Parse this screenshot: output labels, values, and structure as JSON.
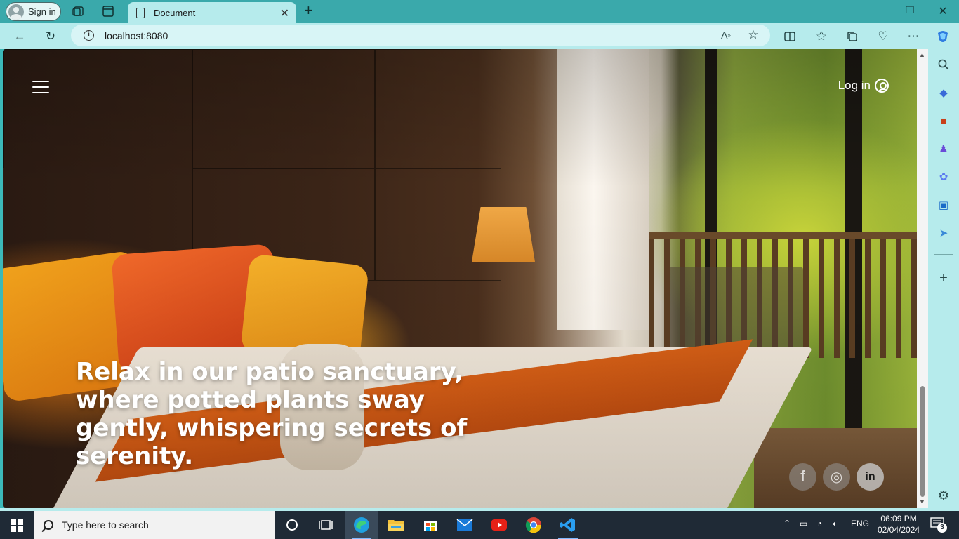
{
  "browser": {
    "profile_label": "Sign in",
    "tab_title": "Document",
    "url": "localhost:8080"
  },
  "page": {
    "login_label": "Log in",
    "hero_text": "Relax in our patio sanctuary, where potted plants sway gently, whispering secrets of serenity.",
    "socials": [
      {
        "name": "facebook",
        "glyph": "f"
      },
      {
        "name": "instagram",
        "glyph": "◎"
      },
      {
        "name": "linkedin",
        "glyph": "in"
      }
    ]
  },
  "taskbar": {
    "search_placeholder": "Type here to search",
    "language": "ENG",
    "time": "06:09 PM",
    "date": "02/04/2024",
    "notification_count": "3"
  },
  "colors": {
    "browser_frame": "#3aa9ab",
    "toolbar": "#b6ebec",
    "taskbar": "#1f2a36"
  }
}
